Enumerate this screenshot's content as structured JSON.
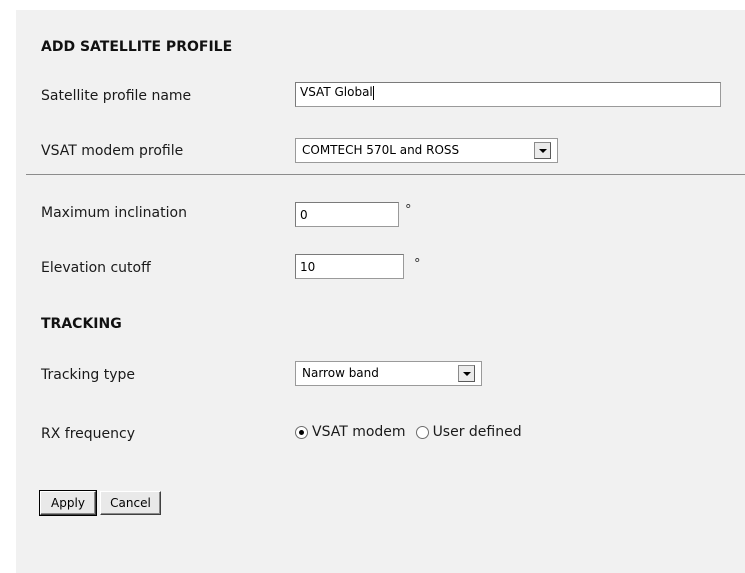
{
  "form": {
    "heading": "ADD SATELLITE PROFILE",
    "profile_name_label": "Satellite profile name",
    "profile_name_value": "VSAT Global",
    "modem_profile_label": "VSAT modem profile",
    "modem_profile_value": "COMTECH 570L and ROSS",
    "max_inclination_label": "Maximum inclination",
    "max_inclination_value": "0",
    "max_inclination_unit": "°",
    "elevation_cutoff_label": "Elevation cutoff",
    "elevation_cutoff_value": "10",
    "elevation_cutoff_unit": "°"
  },
  "tracking": {
    "heading": "TRACKING",
    "type_label": "Tracking type",
    "type_value": "Narrow band",
    "rx_label": "RX frequency",
    "rx_options": [
      {
        "label": "VSAT modem",
        "selected": true
      },
      {
        "label": "User defined",
        "selected": false
      }
    ]
  },
  "buttons": {
    "apply": "Apply",
    "cancel": "Cancel"
  },
  "colors": {
    "panel_background": "#f1f1f1",
    "page_background": "#ffffff"
  }
}
